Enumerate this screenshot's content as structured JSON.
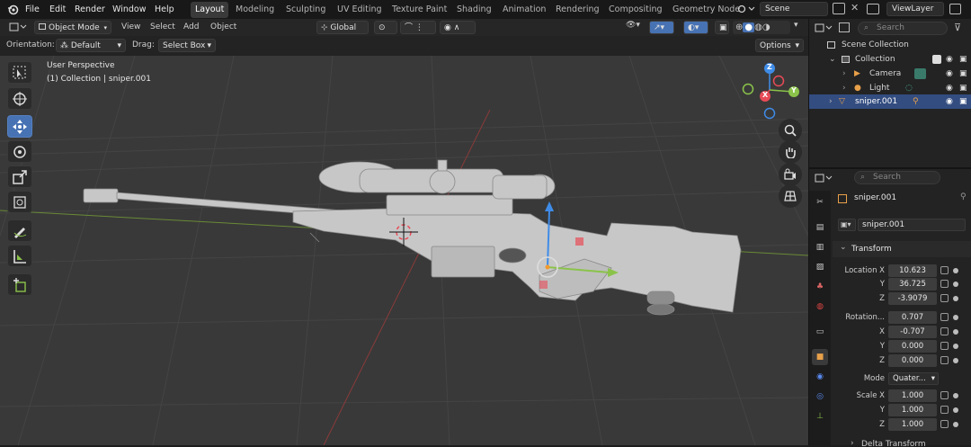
{
  "menu": {
    "file": "File",
    "edit": "Edit",
    "render": "Render",
    "window": "Window",
    "help": "Help"
  },
  "workspaces": [
    "Layout",
    "Modeling",
    "Sculpting",
    "UV Editing",
    "Texture Paint",
    "Shading",
    "Animation",
    "Rendering",
    "Compositing",
    "Geometry Node"
  ],
  "scene": {
    "name": "Scene",
    "view_layer": "ViewLayer"
  },
  "header": {
    "mode": "Object Mode",
    "view": "View",
    "select": "Select",
    "add": "Add",
    "object": "Object",
    "transform_orientation": "Global"
  },
  "tool_settings": {
    "orientation_label": "Orientation:",
    "orientation_value": "Default",
    "drag_label": "Drag:",
    "drag_value": "Select Box",
    "options": "Options"
  },
  "viewport": {
    "perspective": "User Perspective",
    "context": "(1) Collection | sniper.001"
  },
  "gizmo": {
    "x": "X",
    "y": "Y",
    "z": "Z"
  },
  "outliner": {
    "search_placeholder": "Search",
    "scene_collection": "Scene Collection",
    "collection": "Collection",
    "items": [
      {
        "label": "Camera"
      },
      {
        "label": "Light"
      },
      {
        "label": "sniper.001"
      }
    ]
  },
  "properties": {
    "search_placeholder": "Search",
    "object_name": "sniper.001",
    "data_name": "sniper.001",
    "transform_header": "Transform",
    "delta_header": "Delta Transform",
    "location_label": "Location X",
    "rotation_label": "Rotation...",
    "mode_label": "Mode",
    "mode_value": "Quater...",
    "scale_label": "Scale X",
    "axis_y": "Y",
    "axis_z": "Z",
    "axis_x": "X",
    "location": [
      "10.623",
      "36.725",
      "-3.9079"
    ],
    "rotation": [
      "0.707",
      "-0.707",
      "0.000",
      "0.000"
    ],
    "scale": [
      "1.000",
      "1.000",
      "1.000"
    ]
  },
  "colors": {
    "accent": "#4772b3",
    "x_axis": "#e84b57",
    "y_axis": "#8bc34a",
    "z_axis": "#3f8ce8",
    "active_row": "#334d80"
  }
}
